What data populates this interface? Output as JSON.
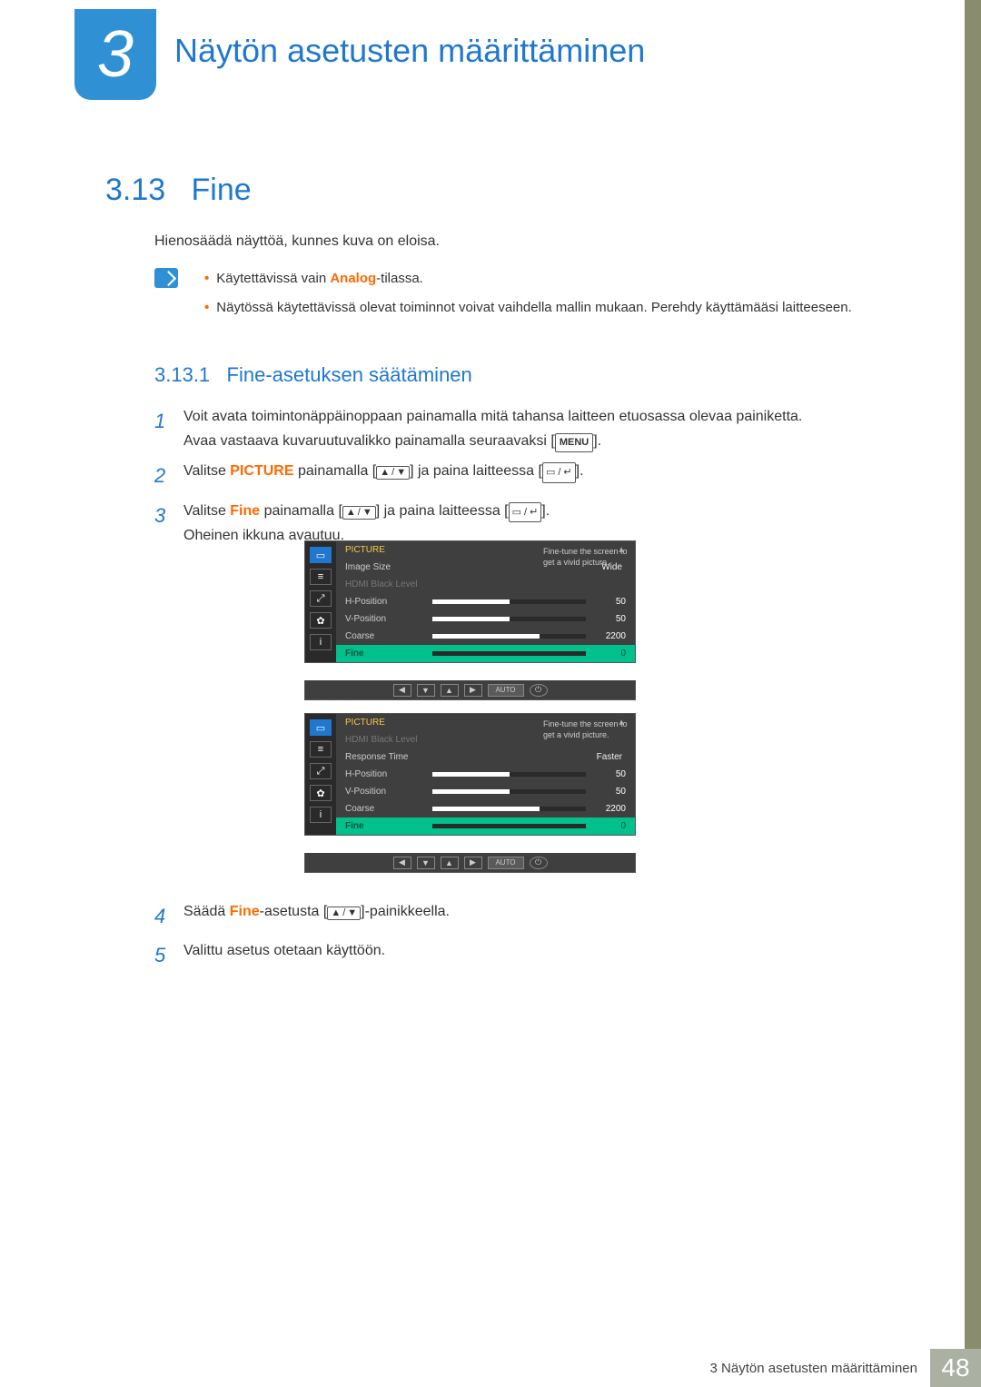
{
  "chapter": {
    "number": "3",
    "title": "Näytön asetusten määrittäminen"
  },
  "section": {
    "number": "3.13",
    "title": "Fine"
  },
  "intro": "Hienosäädä näyttöä, kunnes kuva on eloisa.",
  "notes": {
    "analog_pre": "Käytettävissä vain ",
    "analog_word": "Analog",
    "analog_post": "-tilassa.",
    "line2": "Näytössä käytettävissä olevat toiminnot voivat vaihdella mallin mukaan. Perehdy käyttämääsi laitteeseen."
  },
  "subsection": {
    "number": "3.13.1",
    "title": "Fine-asetuksen säätäminen"
  },
  "steps": {
    "s1a": "Voit avata toimintonäppäinoppaan painamalla mitä tahansa laitteen etuosassa olevaa painiketta.",
    "s1b_pre": "Avaa vastaava kuvaruutuvalikko painamalla seuraavaksi [",
    "s1b_post": "].",
    "menu_key": "MENU",
    "s2_pre": "Valitse ",
    "s2_word": "PICTURE",
    "s2_mid": " painamalla [",
    "s2_mid2": "] ja paina laitteessa [",
    "s2_end": "].",
    "s3_pre": "Valitse ",
    "s3_word": "Fine",
    "s3_mid": " painamalla [",
    "s3_mid2": "] ja paina laitteessa [",
    "s3_end": "].",
    "s3_line2": "Oheinen ikkuna avautuu.",
    "s4_pre": "Säädä ",
    "s4_word": "Fine",
    "s4_mid": "-asetusta [",
    "s4_end": "]-painikkeella.",
    "s5": "Valittu asetus otetaan käyttöön."
  },
  "osd": {
    "title": "PICTURE",
    "side_text": "Fine-tune the screen to get a vivid picture.",
    "menu1": {
      "rows": [
        {
          "label": "Image Size",
          "text": "Wide"
        },
        {
          "label": "HDMI Black Level",
          "disabled": true
        },
        {
          "label": "H-Position",
          "val": "50",
          "fill": 50
        },
        {
          "label": "V-Position",
          "val": "50",
          "fill": 50
        },
        {
          "label": "Coarse",
          "val": "2200",
          "fill": 70
        },
        {
          "label": "Fine",
          "val": "0",
          "fill": 0,
          "hl": true
        }
      ]
    },
    "menu2": {
      "rows": [
        {
          "label": "HDMI Black Level",
          "disabled": true
        },
        {
          "label": "Response Time",
          "text": "Faster"
        },
        {
          "label": "H-Position",
          "val": "50",
          "fill": 50
        },
        {
          "label": "V-Position",
          "val": "50",
          "fill": 50
        },
        {
          "label": "Coarse",
          "val": "2200",
          "fill": 70
        },
        {
          "label": "Fine",
          "val": "0",
          "fill": 0,
          "hl": true
        }
      ]
    },
    "nav_auto": "AUTO"
  },
  "footer": {
    "text": "3 Näytön asetusten määrittäminen",
    "page": "48"
  }
}
